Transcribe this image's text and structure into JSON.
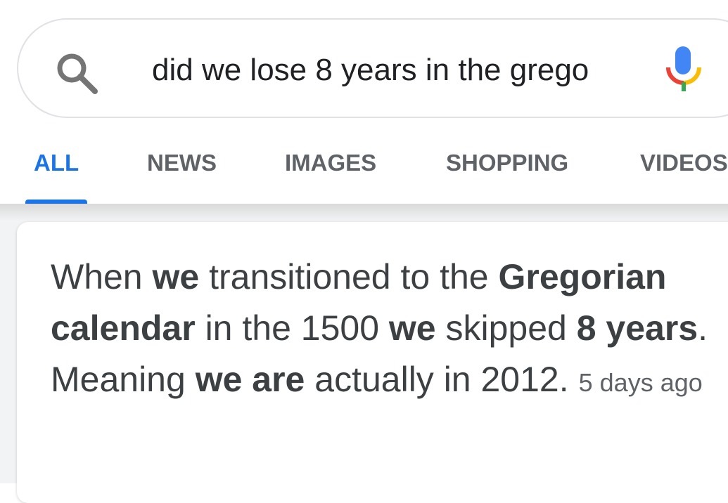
{
  "search": {
    "query": "did we lose 8 years in the grego"
  },
  "tabs": [
    {
      "label": "ALL",
      "active": true
    },
    {
      "label": "NEWS",
      "active": false
    },
    {
      "label": "IMAGES",
      "active": false
    },
    {
      "label": "SHOPPING",
      "active": false
    },
    {
      "label": "VIDEOS",
      "active": false
    }
  ],
  "snippet": {
    "segments": [
      {
        "text": "When ",
        "bold": false
      },
      {
        "text": "we",
        "bold": true
      },
      {
        "text": " transitioned to the ",
        "bold": false
      },
      {
        "text": "Gregorian calendar",
        "bold": true
      },
      {
        "text": " in the 1500 ",
        "bold": false
      },
      {
        "text": "we",
        "bold": true
      },
      {
        "text": " skipped ",
        "bold": false
      },
      {
        "text": "8 years",
        "bold": true
      },
      {
        "text": ". Meaning ",
        "bold": false
      },
      {
        "text": "we are",
        "bold": true
      },
      {
        "text": " actually in 2012.",
        "bold": false
      }
    ],
    "date": "5 days ago"
  },
  "icons": {
    "search": "search-icon",
    "mic": "mic-icon"
  },
  "colors": {
    "active_tab": "#1a73e8",
    "inactive_tab": "#5f6368",
    "text": "#3c4043",
    "mic_blue": "#4285f4",
    "mic_red": "#ea4335",
    "mic_yellow": "#fbbc05",
    "mic_green": "#34a853"
  }
}
